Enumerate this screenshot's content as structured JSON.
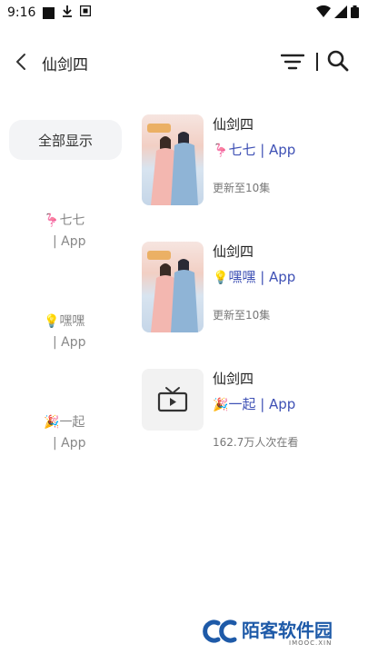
{
  "status_bar": {
    "time": "9:16"
  },
  "header": {
    "title": "仙剑四"
  },
  "sidebar": {
    "show_all_label": "全部显示",
    "sources": [
      {
        "emoji": "🦩",
        "name": "七七",
        "tag": "| App"
      },
      {
        "emoji": "💡",
        "name": "嘿嘿",
        "tag": "| App"
      },
      {
        "emoji": "🎉",
        "name": "一起",
        "tag": "| App"
      }
    ]
  },
  "results": [
    {
      "title": "仙剑四",
      "source_emoji": "🦩",
      "source": "七七 | App",
      "meta": "更新至10集",
      "poster": "art"
    },
    {
      "title": "仙剑四",
      "source_emoji": "💡",
      "source": "嘿嘿 | App",
      "meta": "更新至10集",
      "poster": "art"
    },
    {
      "title": "仙剑四",
      "source_emoji": "🎉",
      "source": "一起 | App",
      "meta": "162.7万人次在看",
      "poster": "tv-placeholder"
    }
  ],
  "watermark": {
    "text": "陌客软件园",
    "sub": "IMOOC.XIN"
  }
}
